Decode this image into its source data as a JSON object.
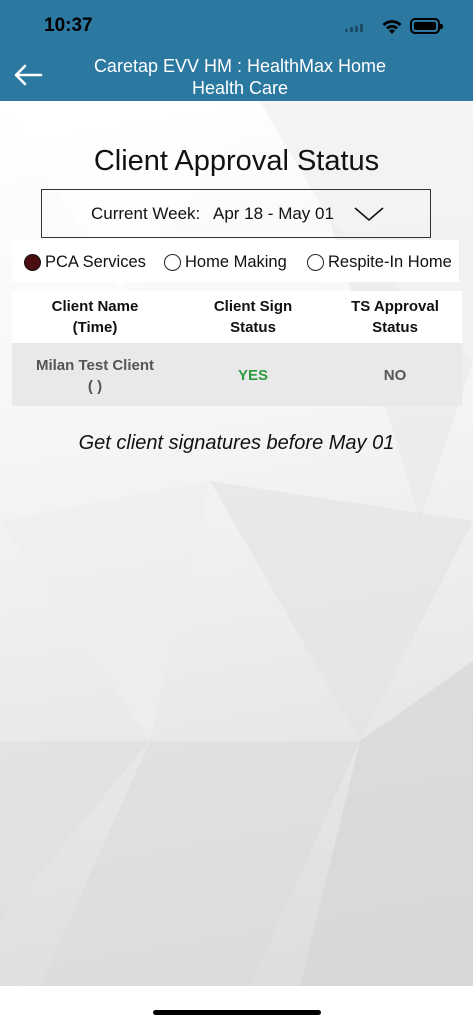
{
  "status_bar": {
    "time": "10:37"
  },
  "header": {
    "title": "Caretap EVV HM : HealthMax Home Health Care",
    "back_icon": "arrow-left-icon",
    "background_color": "#2b78a0"
  },
  "main": {
    "title": "Client Approval Status",
    "week_selector": {
      "label": "Current Week:",
      "value": "Apr 18 - May 01",
      "icon": "chevron-down-icon"
    },
    "service_options": [
      {
        "label": "PCA Services",
        "selected": true
      },
      {
        "label": "Home Making",
        "selected": false
      },
      {
        "label": "Respite-In Home",
        "selected": false
      }
    ],
    "table": {
      "headers": [
        {
          "line1": "Client Name",
          "line2": "(Time)"
        },
        {
          "line1": "Client Sign",
          "line2": "Status"
        },
        {
          "line1": "TS Approval",
          "line2": "Status"
        }
      ],
      "rows": [
        {
          "client_name": "Milan Test Client",
          "time": "( )",
          "client_sign_status": "YES",
          "ts_approval_status": "NO"
        }
      ]
    },
    "note": "Get client signatures before May 01"
  },
  "colors": {
    "yes": "#2e9a3c",
    "no": "#555555",
    "selected_radio": "#4a0d10"
  }
}
